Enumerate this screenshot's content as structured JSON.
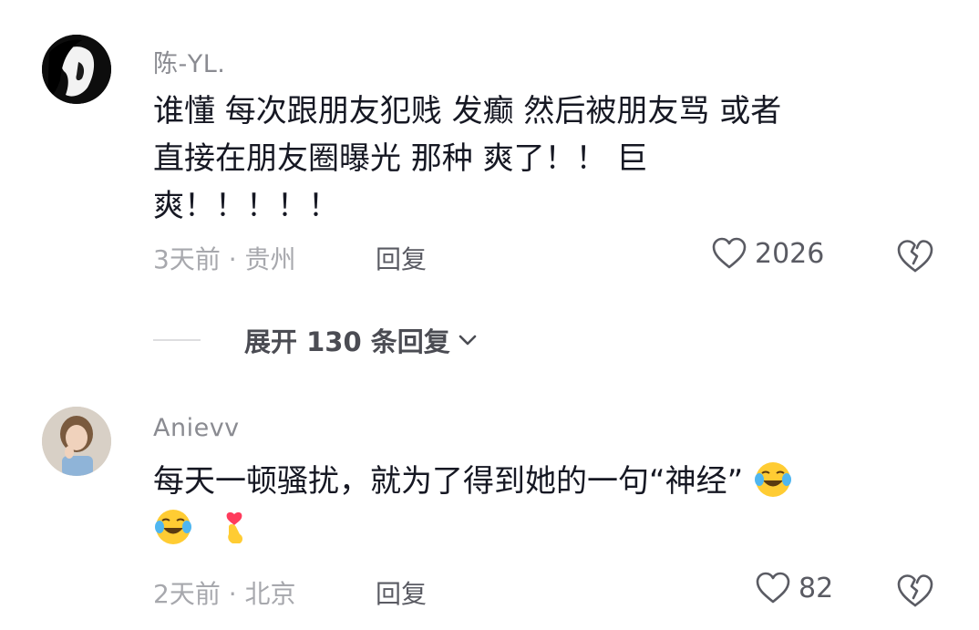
{
  "comments": [
    {
      "username": "陈-YL.",
      "text_line1": "谁懂 每次跟朋友犯贱 发癫 然后被朋友骂 或者",
      "text_line2": "直接在朋友圈曝光 那种 爽了！！ 巨",
      "text_line3": "爽！！！！！",
      "time_location": "3天前 · 贵州",
      "reply_label": "回复",
      "likes": "2026"
    },
    {
      "username": "Anievv",
      "text_line1": "每天一顿骚扰，就为了得到她的一句“神经”",
      "time_location": "2天前 · 北京",
      "reply_label": "回复",
      "likes": "82",
      "emojis": [
        "laugh-cry-emoji",
        "laugh-cry-emoji",
        "finger-heart-emoji"
      ]
    }
  ],
  "expand_replies": {
    "label": "展开 130 条回复"
  },
  "colors": {
    "text": "#161823",
    "muted": "#a7a8ad",
    "username": "#8a8b91",
    "emoji_yellow": "#ffcc33"
  }
}
